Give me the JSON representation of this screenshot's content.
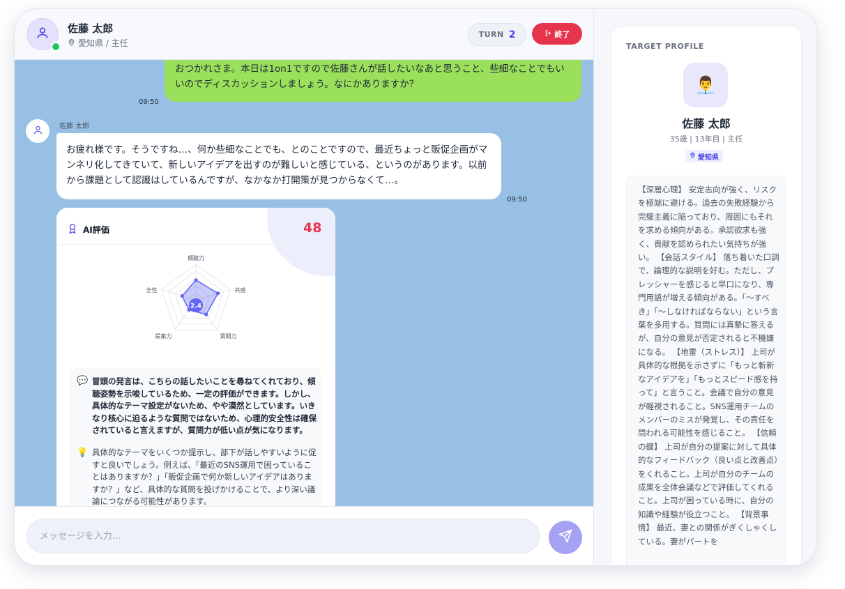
{
  "header": {
    "name": "佐藤 太郎",
    "meta": "愛知県 / 主任",
    "turn_label": "TURN",
    "turn_value": "2",
    "end_label": "終了"
  },
  "messages": {
    "user": {
      "text": "おつかれさま。本日は1on1ですので佐藤さんが話したいなあと思うこと、些細なことでもいいのでディスカッションしましょう。なにかありますか？",
      "time": "09:50"
    },
    "bot": {
      "name": "佐藤 太郎",
      "text": "お疲れ様です。そうですね…、何か些細なことでも、とのことですので、最近ちょっと販促企画がマンネリ化してきていて、新しいアイデアを出すのが難しいと感じている、というのがあります。以前から課題として認識はしているんですが、なかなか打開策が見つからなくて…。",
      "time": "09:50"
    }
  },
  "evaluation": {
    "title": "AI評価",
    "score": "48",
    "radar_center": "2.4",
    "axes": [
      "傾聴力",
      "共感",
      "質問力",
      "提案力",
      "安全性"
    ],
    "axes_display": [
      "傾聴力",
      "共感",
      "質問力",
      "提案力",
      "全性"
    ],
    "values": [
      2.8,
      3.2,
      2.4,
      1.6,
      2.0
    ],
    "max": 5,
    "comment": "冒頭の発言は、こちらの話したいことを尋ねてくれており、傾聴姿勢を示唆しているため、一定の評価ができます。しかし、具体的なテーマ設定がないため、やや漠然としています。いきなり核心に迫るような質問ではないため、心理的安全性は確保されていると言えますが、質問力が低い点が気になります。",
    "advice": "具体的なテーマをいくつか提示し、部下が話しやすいように促すと良いでしょう。例えば、「最近のSNS運用で困っていることはありますか？」「販促企画で何か新しいアイデアはありますか？」など、具体的な質問を投げかけることで、より深い議論につながる可能性があります。"
  },
  "input": {
    "placeholder": "メッセージを入力..."
  },
  "profile": {
    "label": "TARGET PROFILE",
    "avatar_emoji": "👨‍💼",
    "name": "佐藤 太郎",
    "meta": "35歳 | 13年目 | 主任",
    "location": "愛知県",
    "description": "【深層心理】 安定志向が強く、リスクを極端に避ける。過去の失敗経験から完璧主義に陥っており、周囲にもそれを求める傾向がある。承認欲求も強く、貢献を認められたい気持ちが強い。 【会話スタイル】 落ち着いた口調で、論理的な説明を好む。ただし、プレッシャーを感じると早口になり、専門用語が増える傾向がある。「〜すべき」「〜しなければならない」という言葉を多用する。質問には真摯に答えるが、自分の意見が否定されると不機嫌になる。 【地雷（ストレス）】 上司が具体的な根拠を示さずに「もっと斬新なアイデアを」「もっとスピード感を持って」と言うこと。会議で自分の意見が軽視されること。SNS運用チームのメンバーのミスが発覚し、その責任を問われる可能性を感じること。 【信頼の鍵】 上司が自分の提案に対して具体的なフィードバック（良い点と改善点）をくれること。上司が自分のチームの成果を全体会議などで評価してくれること。上司が困っている時に、自分の知識や経験が役立つこと。 【背景事情】 最近、妻との関係がぎくしゃくしている。妻がパートを"
  },
  "colors": {
    "user_bubble": "#9ae05a",
    "chat_bg": "#97c0e4",
    "accent": "#4f46e5",
    "danger": "#e6344d"
  }
}
